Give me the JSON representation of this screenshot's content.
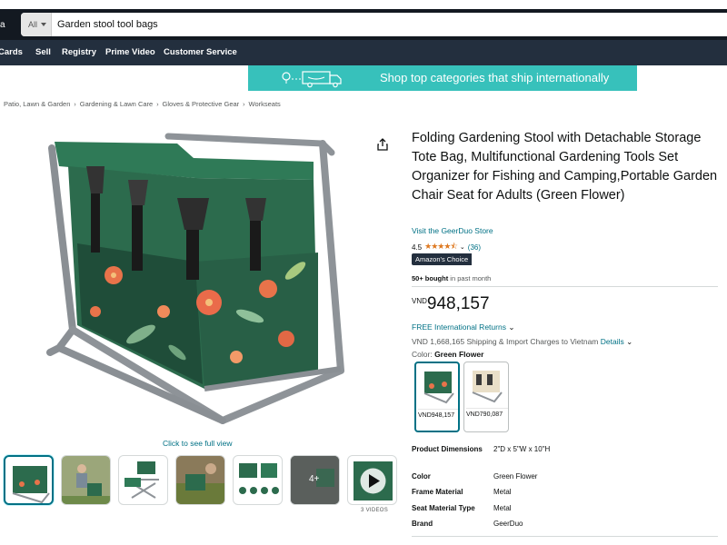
{
  "header": {
    "search_dept": "All",
    "search_value": "Garden stool tool bags"
  },
  "nav": {
    "items": [
      "Cards",
      "Sell",
      "Registry",
      "Prime Video",
      "Customer Service"
    ]
  },
  "banner": {
    "text": "Shop top categories that ship internationally"
  },
  "breadcrumb": [
    "Patio, Lawn & Garden",
    "Gardening & Lawn Care",
    "Gloves & Protective Gear",
    "Workseats"
  ],
  "gallery": {
    "full_view_link": "Click to see full view",
    "more_count": "4+",
    "videos_label": "3 VIDEOS"
  },
  "product": {
    "title": "Folding Gardening Stool with Detachable Storage Tote Bag, Multifunctional Gardening Tools Set Organizer for Fishing and Camping,Portable Garden Chair Seat for Adults (Green Flower)",
    "store_link": "Visit the GeerDuo Store",
    "rating_value": "4.5",
    "rating_stars": 4.5,
    "rating_count": "(36)",
    "badge": "Amazon's Choice",
    "bought_bold": "50+ bought",
    "bought_rest": " in past month",
    "price_currency": "VND",
    "price_amount": "948,157",
    "returns": "FREE International Returns",
    "shipping_text": "VND 1,668,165 Shipping & Import Charges to Vietnam",
    "shipping_link": "Details",
    "color_label": "Color:",
    "color_value": "Green Flower",
    "swatches": [
      {
        "price": "VND948,157",
        "selected": true
      },
      {
        "price": "VND790,087",
        "selected": false
      }
    ],
    "specs": [
      {
        "key": "Product Dimensions",
        "value": "2\"D x 5\"W x 10\"H"
      },
      {
        "key": "Color",
        "value": "Green Flower"
      },
      {
        "key": "Frame Material",
        "value": "Metal"
      },
      {
        "key": "Seat Material Type",
        "value": "Metal"
      },
      {
        "key": "Brand",
        "value": "GeerDuo"
      }
    ]
  },
  "colors": {
    "header_bg": "#131921",
    "nav_bg": "#232f3e",
    "banner_bg": "#37c1bb",
    "link": "#007185",
    "star": "#de7921",
    "bag_green": "#2f6e52"
  },
  "icons": [
    "share-icon",
    "chevron-down-icon",
    "play-icon",
    "truck-icon"
  ]
}
